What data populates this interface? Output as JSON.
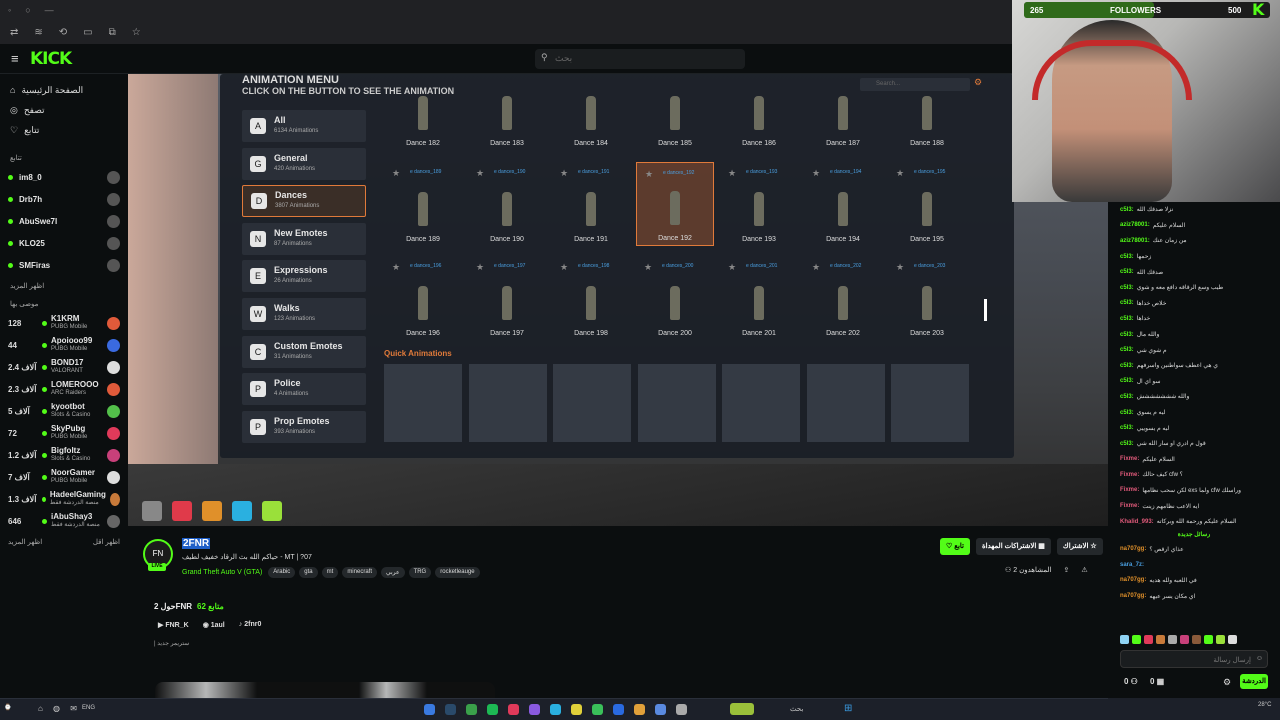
{
  "browser": {
    "nav_icons": [
      "back-icon",
      "forward-icon",
      "reload-icon",
      "sidebar-icon",
      "tabs-icon",
      "star-icon"
    ]
  },
  "header": {
    "logo": "KICK",
    "search_placeholder": "بحث"
  },
  "sidebar": {
    "nav": [
      {
        "label": "الصفحة الرئيسية",
        "icon": "home-icon"
      },
      {
        "label": "تصفح",
        "icon": "compass-icon"
      },
      {
        "label": "تتابع",
        "icon": "heart-icon"
      }
    ],
    "following_title": "تتابع",
    "following": [
      {
        "name": "im8_0"
      },
      {
        "name": "Drb7h"
      },
      {
        "name": "AbuSwe7l"
      },
      {
        "name": "KLO25"
      },
      {
        "name": "SMFiras"
      }
    ],
    "show_more_1": "اظهر المزيد",
    "recommended_title": "موصى بها",
    "recommended": [
      {
        "count": "128",
        "name": "K1KRM",
        "game": "PUBG Mobile",
        "color": "#e05a3a"
      },
      {
        "count": "44",
        "name": "Apoiooo99",
        "game": "PUBG Mobile",
        "color": "#3a6ae0"
      },
      {
        "count": "2.4 آلاف",
        "name": "BOND17",
        "game": "VALORANT",
        "color": "#ddd"
      },
      {
        "count": "2.3 آلاف",
        "name": "LOMEROOO",
        "game": "ARC Raiders",
        "color": "#e05a3a"
      },
      {
        "count": "5 آلاف",
        "name": "kyootbot",
        "game": "Slots & Casino",
        "color": "#53c04a"
      },
      {
        "count": "72",
        "name": "SkyPubg",
        "game": "PUBG Mobile",
        "color": "#e03a5a"
      },
      {
        "count": "1.2 آلاف",
        "name": "Bigfoltz",
        "game": "Slots & Casino",
        "color": "#c8407a"
      },
      {
        "count": "7 آلاف",
        "name": "NoorGamer",
        "game": "PUBG Mobile",
        "color": "#ddd"
      },
      {
        "count": "1.3 آلاف",
        "name": "HadeelGaming",
        "game": "منصة الدردشة فقط",
        "color": "#c87a3a"
      },
      {
        "count": "646",
        "name": "iAbuShay3",
        "game": "منصة الدردشة فقط",
        "color": "#666"
      }
    ],
    "show_more_2": "اظهر المزيد",
    "show_less": "اظهر اقل"
  },
  "game": {
    "menu_title": "ANIMATION MENU",
    "menu_subtitle": "CLICK ON THE BUTTON TO SEE THE ANIMATION",
    "menu_search": "Search...",
    "categories": [
      {
        "name": "All",
        "sub": "6134 Animations",
        "icon": "A"
      },
      {
        "name": "General",
        "sub": "420 Animations",
        "icon": "G"
      },
      {
        "name": "Dances",
        "sub": "3807 Animations",
        "icon": "D",
        "selected": true
      },
      {
        "name": "New Emotes",
        "sub": "87 Animations",
        "icon": "N"
      },
      {
        "name": "Expressions",
        "sub": "26 Animations",
        "icon": "E"
      },
      {
        "name": "Walks",
        "sub": "123 Animations",
        "icon": "W"
      },
      {
        "name": "Custom Emotes",
        "sub": "31 Animations",
        "icon": "C"
      },
      {
        "name": "Police",
        "sub": "4 Animations",
        "icon": "P"
      },
      {
        "name": "Prop Emotes",
        "sub": "393 Animations",
        "icon": "P"
      }
    ],
    "row1": [
      "Dance 182",
      "Dance 183",
      "Dance 184",
      "Dance 185",
      "Dance 186",
      "Dance 187",
      "Dance 188"
    ],
    "row2": [
      "Dance 189",
      "Dance 190",
      "Dance 191",
      "Dance 192",
      "Dance 193",
      "Dance 194",
      "Dance 195"
    ],
    "row2_tags": [
      "e dances_189",
      "e dances_190",
      "e dances_191",
      "e dances_192",
      "e dances_193",
      "e dances_194",
      "e dances_195"
    ],
    "row3": [
      "Dance 196",
      "Dance 197",
      "Dance 198",
      "Dance 200",
      "Dance 201",
      "Dance 202",
      "Dance 203"
    ],
    "row3_tags": [
      "e dances_196",
      "e dances_197",
      "e dances_198",
      "e dances_200",
      "e dances_201",
      "e dances_202",
      "e dances_203"
    ],
    "quick_title": "Quick Animations"
  },
  "webcam": {
    "bar_left": "265",
    "bar_label": "FOLLOWERS",
    "bar_right": "500",
    "progress": 0.53
  },
  "chat": {
    "messages": [
      {
        "user": "c5l3:",
        "text": "نزلا صدقك الله"
      },
      {
        "user": "aziz78001:",
        "text": "السلام عليكم"
      },
      {
        "user": "aziz78001:",
        "text": "من زمان عنك"
      },
      {
        "user": "c5l3:",
        "text": "زحمها"
      },
      {
        "user": "c5l3:",
        "text": "صدقك الله"
      },
      {
        "user": "c5l3:",
        "text": "طيب وسع الرقاقه دافع معه و شوي"
      },
      {
        "user": "c5l3:",
        "text": "خلاص خداها"
      },
      {
        "user": "c5l3:",
        "text": "خداها"
      },
      {
        "user": "c5l3:",
        "text": "والله مال"
      },
      {
        "user": "c5l3:",
        "text": "م شوي شي"
      },
      {
        "user": "c5l3:",
        "text": "ي هي اعطف سواطنين واسرفهم"
      },
      {
        "user": "c5l3:",
        "text": "سو اي ال"
      },
      {
        "user": "c5l3:",
        "text": "والله ششششششش"
      },
      {
        "user": "c5l3:",
        "text": "ليه م يسوي"
      },
      {
        "user": "c5l3:",
        "text": "ليه م يسوييي"
      },
      {
        "user": "c5l3:",
        "text": "قول م ادري او سار الله شي"
      },
      {
        "user": "Fixme:",
        "text": "السلام عليكم"
      },
      {
        "user": "Fixme:",
        "text": "كيف حالك cfw ؟"
      },
      {
        "user": "Fixme:",
        "text": "لكن سحب نظامها exs ولما cfw وراسلك"
      },
      {
        "user": "Fixme:",
        "text": "ايه الاعب نظامهم زينت"
      },
      {
        "user": "Khalid_993:",
        "text": "السلام عليكم ورحمة الله وبركاته"
      }
    ],
    "divider": "رسائل جديدة",
    "new_messages": [
      {
        "user": "na707gg:",
        "text": "عذاي ارقص ؟"
      },
      {
        "user": "sara_7z:",
        "text": ""
      },
      {
        "user": "na707gg:",
        "text": "في اللعبه ولله هديه"
      },
      {
        "user": "na707gg:",
        "text": "اي مكان يسر عيهه"
      }
    ],
    "input_placeholder": "إرسال رسالة",
    "send_label": "الدردشة",
    "counters": [
      "0",
      "0"
    ]
  },
  "stream": {
    "avatar_text": "FN",
    "live_badge": "LIVE",
    "channel_name": "2FNR",
    "title": "حياكم الله بث الرقاد خفيف لطيف - MT | ?07",
    "game": "Grand Theft Auto V (GTA)",
    "tags": [
      "Arabic",
      "gta",
      "mt",
      "minecraft",
      "عربي",
      "TRG",
      "rocketleauge"
    ],
    "follow_label": "تابع",
    "subscriptions_label": "الاشتراكات المهداة",
    "subscribe_label": "الاشتراك",
    "viewers": "2 المشاهدون",
    "about_title": "حول 2FNR",
    "followers_count": "62 متابع",
    "socials": [
      {
        "label": "FNR_K",
        "icon": "youtube-icon"
      },
      {
        "label": "1aul",
        "icon": "discord-icon"
      },
      {
        "label": "2fnr0",
        "icon": "tiktok-icon"
      }
    ],
    "about_text": "| ستريمر جديد"
  },
  "taskbar": {
    "weather": "28°C",
    "lang": "ENG",
    "search": "بحث"
  }
}
